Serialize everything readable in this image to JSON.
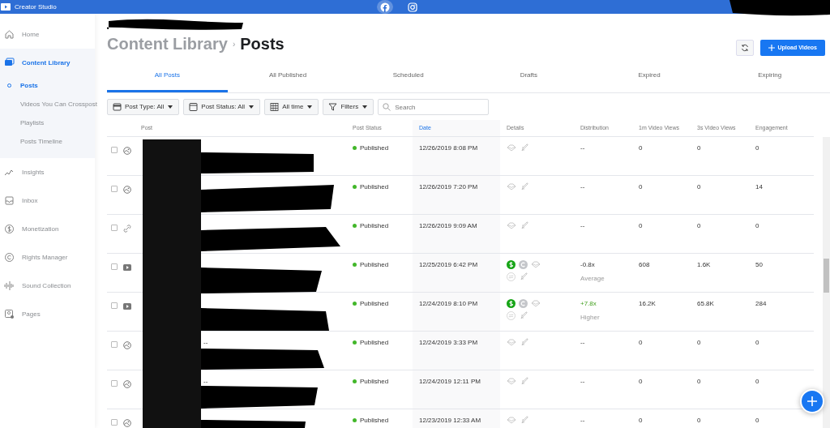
{
  "app": {
    "title": "Creator Studio"
  },
  "topbar": {
    "platforms": [
      {
        "kind": "facebook",
        "selected": true
      },
      {
        "kind": "instagram",
        "selected": false
      }
    ]
  },
  "sidebar": {
    "items": [
      {
        "label": "Home",
        "selected": false
      },
      {
        "label": "Content Library",
        "selected": true,
        "children": [
          {
            "label": "Posts",
            "selected": true
          },
          {
            "label": "Videos You Can Crosspost",
            "selected": false
          },
          {
            "label": "Playlists",
            "selected": false
          },
          {
            "label": "Posts Timeline",
            "selected": false
          }
        ]
      },
      {
        "label": "Insights",
        "selected": false
      },
      {
        "label": "Inbox",
        "selected": false
      },
      {
        "label": "Monetization",
        "selected": false
      },
      {
        "label": "Rights Manager",
        "selected": false
      },
      {
        "label": "Sound Collection",
        "selected": false
      },
      {
        "label": "Pages",
        "selected": false
      }
    ]
  },
  "breadcrumb": {
    "parent": "Content Library",
    "separator": "›",
    "current": "Posts"
  },
  "actions": {
    "upload_label": "Upload Videos"
  },
  "tabs": [
    {
      "label": "All Posts",
      "selected": true
    },
    {
      "label": "All Published",
      "selected": false
    },
    {
      "label": "Scheduled",
      "selected": false
    },
    {
      "label": "Drafts",
      "selected": false
    },
    {
      "label": "Expired",
      "selected": false
    },
    {
      "label": "Expiring",
      "selected": false
    }
  ],
  "filters": [
    {
      "kind": "type",
      "label": "Post Type:",
      "value": "All"
    },
    {
      "kind": "status",
      "label": "Post Status:",
      "value": "All"
    },
    {
      "kind": "time",
      "label": "All time"
    },
    {
      "kind": "filter",
      "label": "Filters"
    }
  ],
  "search": {
    "placeholder": "Search"
  },
  "table": {
    "columns": [
      {
        "label": "Post",
        "sorted": false
      },
      {
        "label": "Post Status",
        "sorted": false
      },
      {
        "label": "Date",
        "sorted": true
      },
      {
        "label": "Details",
        "sorted": false
      },
      {
        "label": "Distribution",
        "sorted": false
      },
      {
        "label": "1m Video Views",
        "sorted": false
      },
      {
        "label": "3s Video Views",
        "sorted": false
      },
      {
        "label": "Engagement",
        "sorted": false
      }
    ],
    "rows": [
      {
        "checked": false,
        "kind": "photo",
        "status": "Published",
        "date": "12/26/2019 8:08 PM",
        "monetized": false,
        "distribution": "--",
        "higher": false,
        "views_1m": "0",
        "views_3s": "0",
        "engagement": "0"
      },
      {
        "checked": false,
        "kind": "photo",
        "status": "Published",
        "date": "12/26/2019 7:20 PM",
        "monetized": false,
        "distribution": "--",
        "higher": false,
        "views_1m": "0",
        "views_3s": "0",
        "engagement": "14"
      },
      {
        "checked": false,
        "kind": "link",
        "status": "Published",
        "date": "12/26/2019 9:09 AM",
        "monetized": false,
        "distribution": "--",
        "higher": false,
        "views_1m": "0",
        "views_3s": "0",
        "engagement": "0"
      },
      {
        "checked": false,
        "kind": "video",
        "status": "Published",
        "date": "12/25/2019 6:42 PM",
        "monetized": true,
        "distribution": "-0.8x",
        "distribution_note": "Average",
        "higher": false,
        "views_1m": "608",
        "views_3s": "1.6K",
        "engagement": "50"
      },
      {
        "checked": false,
        "kind": "video",
        "status": "Published",
        "date": "12/24/2019 8:10 PM",
        "monetized": true,
        "distribution": "+7.8x",
        "distribution_note": "Higher",
        "higher": true,
        "views_1m": "16.2K",
        "views_3s": "65.8K",
        "engagement": "284"
      },
      {
        "checked": false,
        "kind": "photo",
        "post": "--",
        "status": "Published",
        "date": "12/24/2019 3:33 PM",
        "monetized": false,
        "distribution": "--",
        "higher": false,
        "views_1m": "0",
        "views_3s": "0",
        "engagement": "0"
      },
      {
        "checked": false,
        "kind": "photo",
        "post": "--",
        "status": "Published",
        "date": "12/24/2019 12:11 PM",
        "monetized": false,
        "distribution": "--",
        "higher": false,
        "views_1m": "0",
        "views_3s": "0",
        "engagement": "0"
      },
      {
        "checked": false,
        "kind": "photo",
        "status": "Published",
        "date": "12/23/2019 12:33 AM",
        "monetized": false,
        "distribution": "--",
        "higher": false,
        "views_1m": "0",
        "views_3s": "0",
        "engagement": "0"
      }
    ]
  }
}
